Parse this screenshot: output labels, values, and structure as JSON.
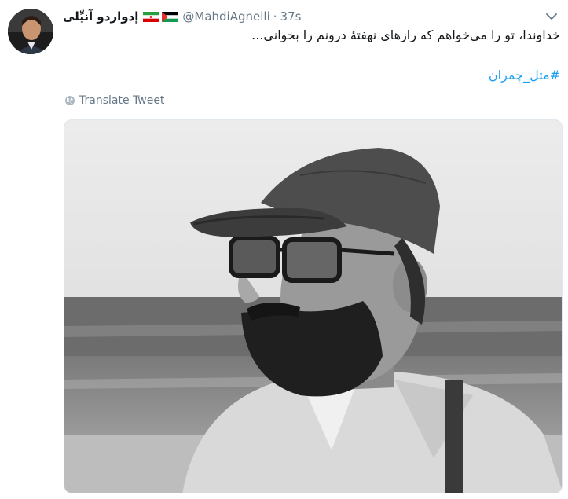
{
  "tweet": {
    "display_name": "إدواردو آنيِّلی",
    "handle": "@MahdiAgnelli",
    "separator": "·",
    "time": "37s",
    "text": "خداوندا، تو را می‌خواهم که رازهای نهفتهٔ درونم را بخوانی...",
    "hashtag": "#مثل_چمران",
    "translate_label": "Translate Tweet",
    "icons": {
      "flag_1": "palestine-flag-icon",
      "flag_2": "iran-flag-icon",
      "menu": "chevron-down-icon",
      "translate": "globe-icon"
    }
  },
  "colors": {
    "link": "#1da1f2",
    "secondary_text": "#657786",
    "primary_text": "#14171a"
  }
}
